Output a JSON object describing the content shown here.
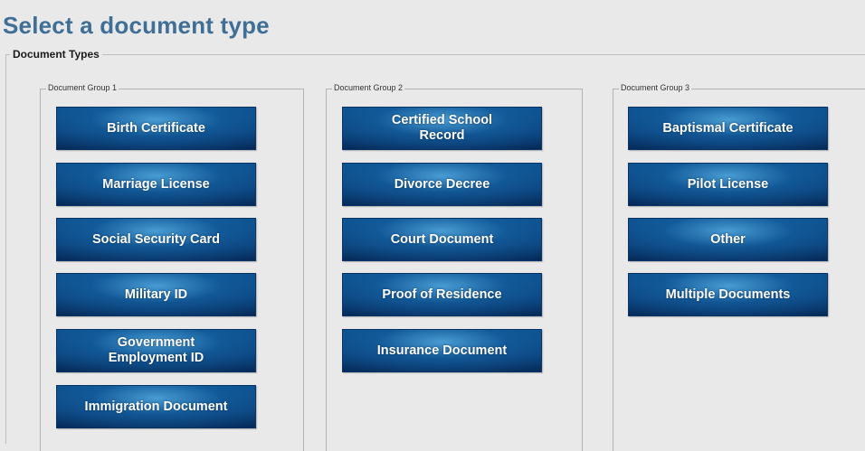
{
  "page": {
    "title": "Select a document type"
  },
  "document_types": {
    "legend": "Document Types",
    "groups": [
      {
        "label": "Document Group 1",
        "buttons": [
          "Birth Certificate",
          "Marriage License",
          "Social Security Card",
          "Military ID",
          "Government\nEmployment ID",
          "Immigration Document"
        ]
      },
      {
        "label": "Document Group 2",
        "buttons": [
          "Certified School\nRecord",
          "Divorce Decree",
          "Court Document",
          "Proof of Residence",
          "Insurance Document"
        ]
      },
      {
        "label": "Document Group 3",
        "buttons": [
          "Baptismal Certificate",
          "Pilot License",
          "Other",
          "Multiple Documents"
        ]
      }
    ]
  }
}
